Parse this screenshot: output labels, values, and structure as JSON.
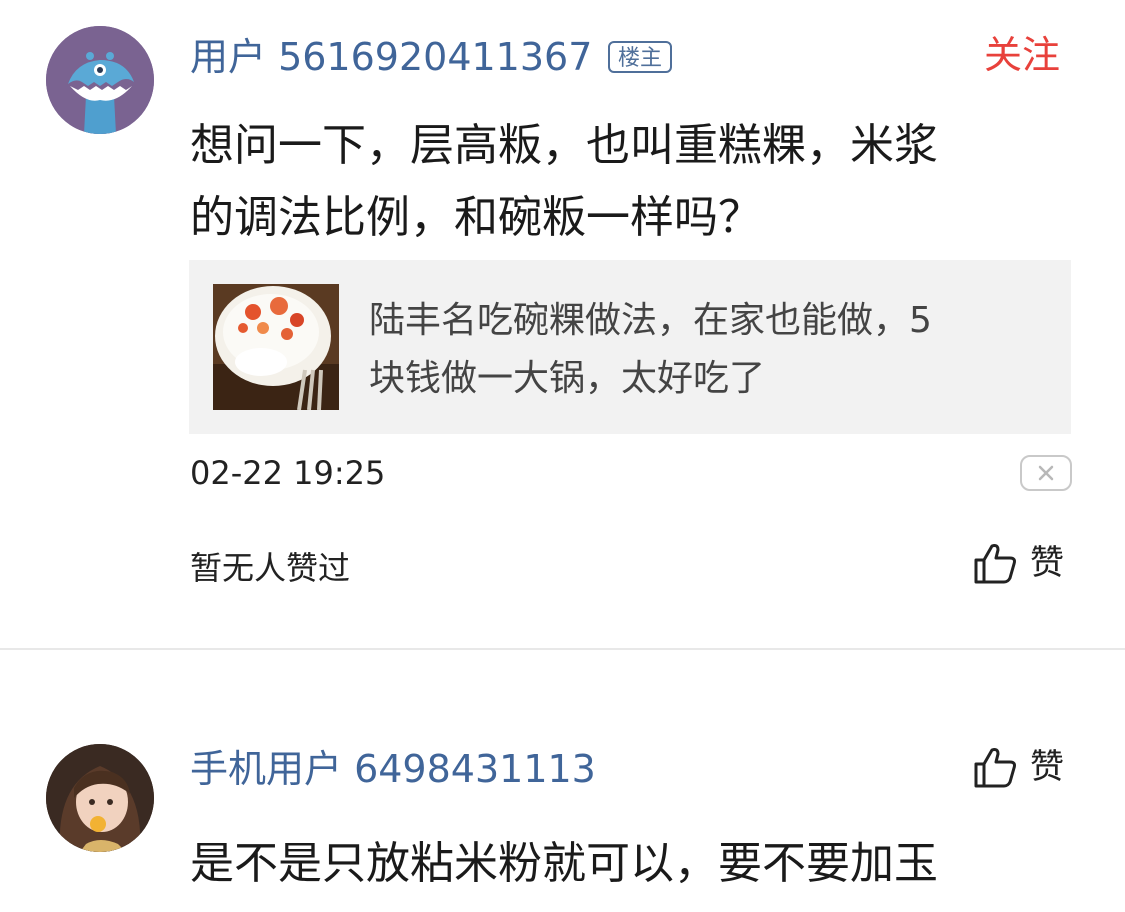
{
  "comments": [
    {
      "username": "用户 5616920411367",
      "badge": "楼主",
      "follow_label": "关注",
      "text_line1": "想问一下，层高粄，也叫重糕粿，米浆",
      "text_line2": "的调法比例，和碗粄一样吗？",
      "quoted_article": {
        "title_line1": "陆丰名吃碗粿做法，在家也能做，5",
        "title_line2": "块钱做一大锅，太好吃了"
      },
      "timestamp": "02-22 19:25",
      "likes_status": "暂无人赞过",
      "like_label": "赞",
      "avatar_color": "#7a6391"
    },
    {
      "username": "手机用户 6498431113",
      "like_label": "赞",
      "text_line1": "是不是只放粘米粉就可以，要不要加玉"
    }
  ],
  "colors": {
    "username": "#406599",
    "follow": "#e8413b",
    "card_bg": "#f2f2f2",
    "divider": "#e8e8e8"
  },
  "icons": [
    "thumbs-up-icon",
    "close-icon"
  ]
}
